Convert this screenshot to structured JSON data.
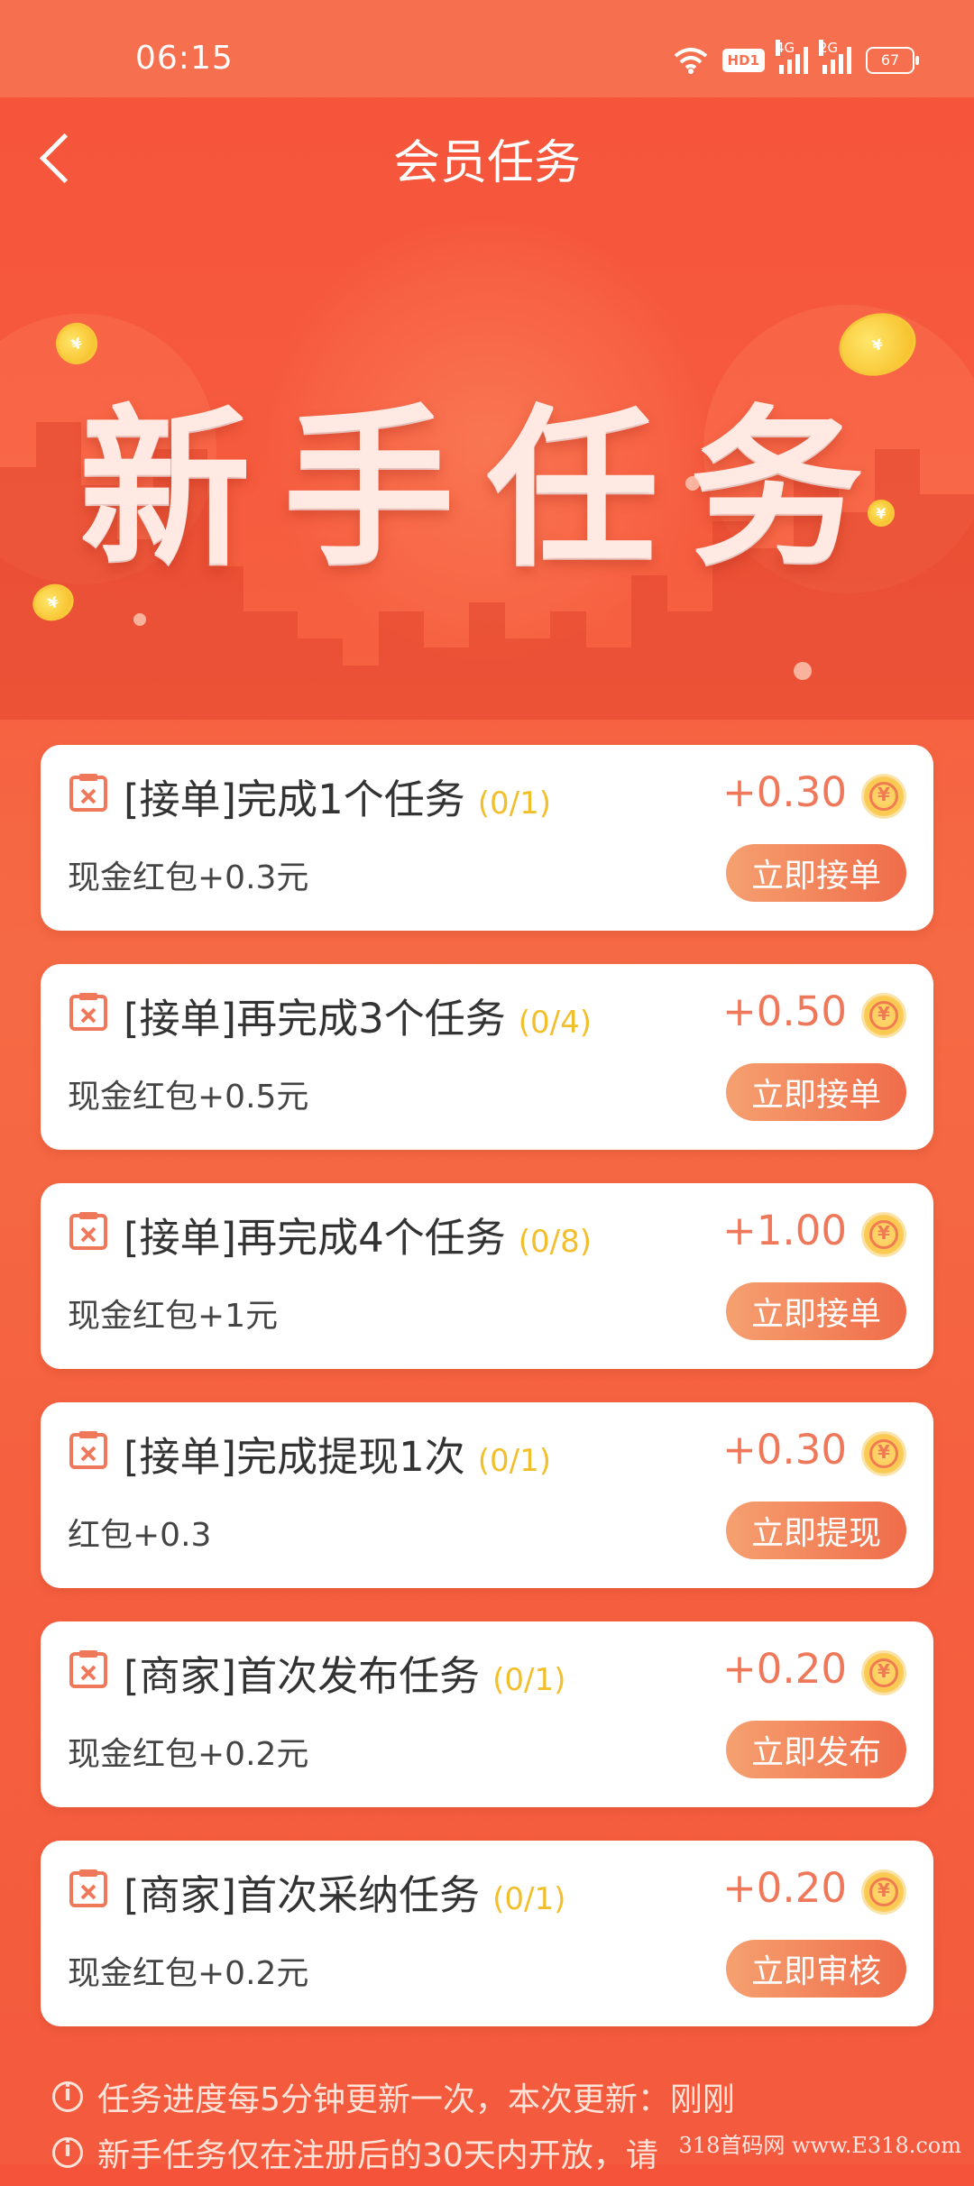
{
  "status_bar": {
    "time": "06:15",
    "hd_label": "HD1",
    "signal_1_label": "4G",
    "signal_2_label": "2G",
    "battery": "67"
  },
  "header": {
    "title": "会员任务"
  },
  "banner": {
    "title": "新手任务"
  },
  "tasks": [
    {
      "title": "[接单]完成1个任务",
      "progress": "(0/1)",
      "amount": "+0.30",
      "desc": "现金红包+0.3元",
      "button": "立即接单"
    },
    {
      "title": "[接单]再完成3个任务",
      "progress": "(0/4)",
      "amount": "+0.50",
      "desc": "现金红包+0.5元",
      "button": "立即接单"
    },
    {
      "title": "[接单]再完成4个任务",
      "progress": "(0/8)",
      "amount": "+1.00",
      "desc": "现金红包+1元",
      "button": "立即接单"
    },
    {
      "title": "[接单]完成提现1次",
      "progress": "(0/1)",
      "amount": "+0.30",
      "desc": "红包+0.3",
      "button": "立即提现"
    },
    {
      "title": "[商家]首次发布任务",
      "progress": "(0/1)",
      "amount": "+0.20",
      "desc": "现金红包+0.2元",
      "button": "立即发布"
    },
    {
      "title": "[商家]首次采纳任务",
      "progress": "(0/1)",
      "amount": "+0.20",
      "desc": "现金红包+0.2元",
      "button": "立即审核"
    }
  ],
  "notes": [
    "任务进度每5分钟更新一次，本次更新：刚刚",
    "新手任务仅在注册后的30天内开放，请"
  ],
  "watermark": "318首码网 www.E318.com"
}
